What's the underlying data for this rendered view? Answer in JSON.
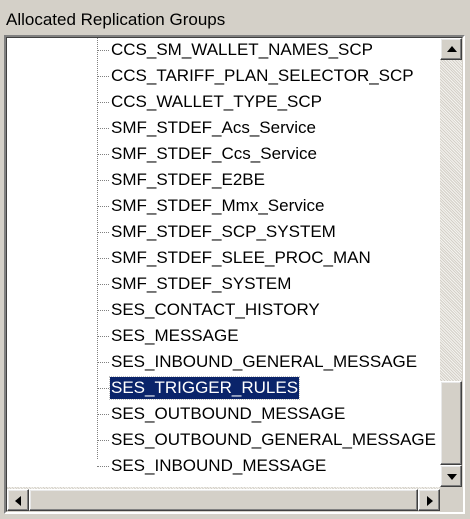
{
  "panel": {
    "label": "Allocated Replication Groups"
  },
  "tree": {
    "items": [
      {
        "label": "CCS_SM_WALLET_NAMES_SCP",
        "selected": false
      },
      {
        "label": "CCS_TARIFF_PLAN_SELECTOR_SCP",
        "selected": false
      },
      {
        "label": "CCS_WALLET_TYPE_SCP",
        "selected": false
      },
      {
        "label": "SMF_STDEF_Acs_Service",
        "selected": false
      },
      {
        "label": "SMF_STDEF_Ccs_Service",
        "selected": false
      },
      {
        "label": "SMF_STDEF_E2BE",
        "selected": false
      },
      {
        "label": "SMF_STDEF_Mmx_Service",
        "selected": false
      },
      {
        "label": "SMF_STDEF_SCP_SYSTEM",
        "selected": false
      },
      {
        "label": "SMF_STDEF_SLEE_PROC_MAN",
        "selected": false
      },
      {
        "label": "SMF_STDEF_SYSTEM",
        "selected": false
      },
      {
        "label": "SES_CONTACT_HISTORY",
        "selected": false
      },
      {
        "label": "SES_MESSAGE",
        "selected": false
      },
      {
        "label": "SES_INBOUND_GENERAL_MESSAGE",
        "selected": false
      },
      {
        "label": "SES_TRIGGER_RULES",
        "selected": true
      },
      {
        "label": "SES_OUTBOUND_MESSAGE",
        "selected": false
      },
      {
        "label": "SES_OUTBOUND_GENERAL_MESSAGE",
        "selected": false
      },
      {
        "label": "SES_INBOUND_MESSAGE",
        "selected": false
      }
    ]
  },
  "scrollbars": {
    "vertical_position": 0.9,
    "horizontal_position": 0.0
  },
  "colors": {
    "selection_bg": "#0a246a",
    "selection_fg": "#ffffff",
    "face": "#d4d0c8"
  }
}
